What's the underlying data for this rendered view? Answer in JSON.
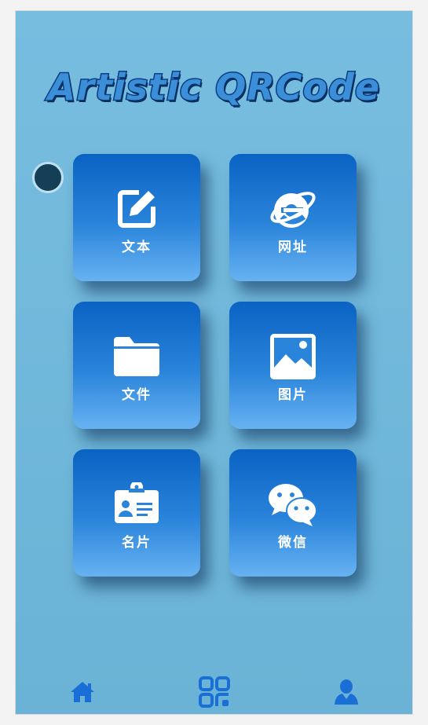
{
  "header": {
    "title": "Artistic QRCode"
  },
  "tiles": [
    {
      "label": "文本",
      "icon": "edit-icon"
    },
    {
      "label": "网址",
      "icon": "ie-browser-icon"
    },
    {
      "label": "文件",
      "icon": "folder-icon"
    },
    {
      "label": "图片",
      "icon": "image-icon"
    },
    {
      "label": "名片",
      "icon": "id-card-icon"
    },
    {
      "label": "微信",
      "icon": "wechat-icon"
    }
  ],
  "nav": {
    "items": [
      {
        "icon": "home-icon"
      },
      {
        "icon": "qrcode-icon"
      },
      {
        "icon": "user-icon"
      }
    ]
  },
  "colors": {
    "accent": "#0a62c3",
    "nav_icon": "#1a6fd6",
    "background": "#6ab3d6"
  }
}
